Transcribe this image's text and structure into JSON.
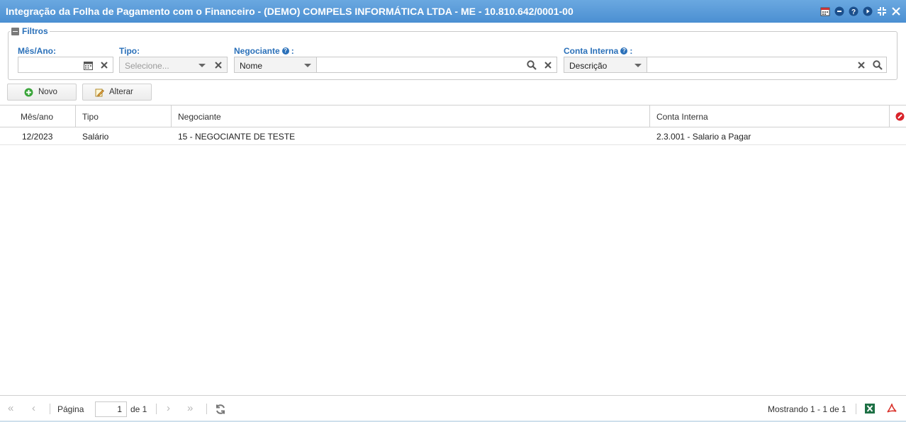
{
  "window": {
    "title": "Integração da Folha de Pagamento com o Financeiro - (DEMO) COMPELS INFORMÁTICA LTDA - ME - 10.810.642/0001-00",
    "icons": [
      "calendar-icon",
      "minimize-icon",
      "help-icon",
      "next-icon",
      "restore-icon",
      "close-icon"
    ]
  },
  "filters": {
    "legend": "Filtros",
    "mes_ano": {
      "label": "Mês/Ano:",
      "value": ""
    },
    "tipo": {
      "label": "Tipo:",
      "placeholder": "Selecione..."
    },
    "negociante": {
      "label": "Negociante",
      "suffix": ":",
      "mode": "Nome",
      "value": ""
    },
    "conta_interna": {
      "label": "Conta Interna",
      "suffix": ":",
      "mode": "Descrição",
      "value": ""
    }
  },
  "toolbar": {
    "novo": "Novo",
    "alterar": "Alterar"
  },
  "grid": {
    "columns": [
      "Mês/ano",
      "Tipo",
      "Negociante",
      "Conta Interna"
    ],
    "rows": [
      {
        "mes_ano": "12/2023",
        "tipo": "Salário",
        "negociante": "15 - NEGOCIANTE DE TESTE",
        "conta": "2.3.001 - Salario a Pagar"
      }
    ]
  },
  "paging": {
    "page_label": "Página",
    "page": "1",
    "of_label": "de 1",
    "display": "Mostrando 1 - 1 de 1"
  },
  "colors": {
    "title_bar": "#4b8fd2",
    "label": "#2a70b9",
    "excel": "#1d7044",
    "pdf": "#d9322b"
  }
}
